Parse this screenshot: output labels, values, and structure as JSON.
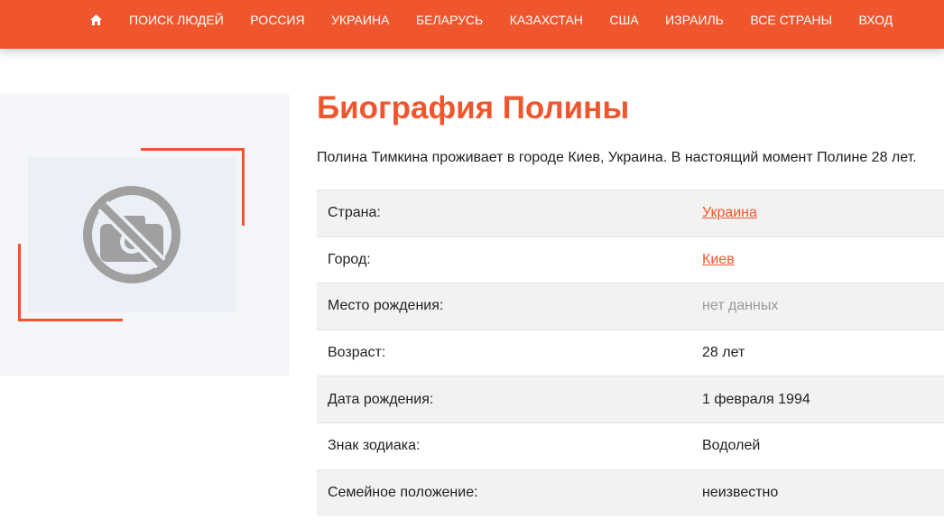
{
  "nav": {
    "items": [
      "Поиск людей",
      "Россия",
      "Украина",
      "Беларусь",
      "Казахстан",
      "США",
      "Израиль",
      "Все страны",
      "Вход"
    ]
  },
  "bio": {
    "title": "Биография Полины",
    "text": "Полина Тимкина проживает в городе Киев, Украина. В настоящий момент Полине 28 лет."
  },
  "table": {
    "rows": [
      {
        "label": "Страна:",
        "value": "Украина",
        "kind": "link"
      },
      {
        "label": "Город:",
        "value": "Киев",
        "kind": "link"
      },
      {
        "label": "Место рождения:",
        "value": "нет данных",
        "kind": "muted"
      },
      {
        "label": "Возраст:",
        "value": "28 лет",
        "kind": "text"
      },
      {
        "label": "Дата рождения:",
        "value": "1 февраля 1994",
        "kind": "text"
      },
      {
        "label": "Знак зодиака:",
        "value": "Водолей",
        "kind": "text"
      },
      {
        "label": "Семейное положение:",
        "value": "неизвестно",
        "kind": "text"
      }
    ]
  },
  "colors": {
    "accent": "#f0562e",
    "muted": "#999999"
  }
}
